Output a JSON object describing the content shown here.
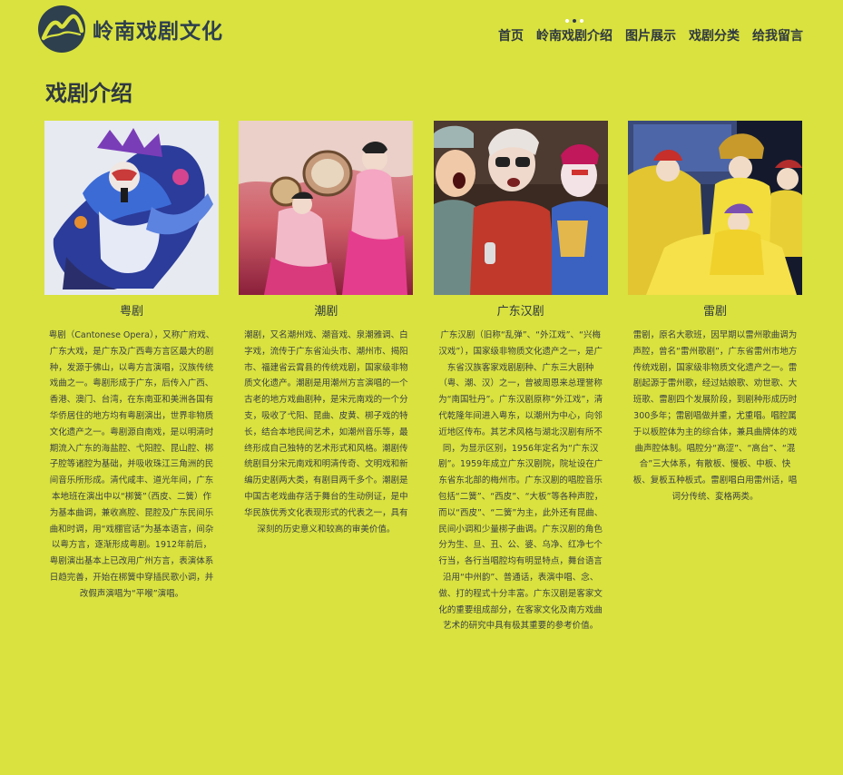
{
  "site": {
    "name": "岭南戏剧文化",
    "logo_icon": "mountain-wave-logo"
  },
  "nav": {
    "items": [
      {
        "label": "首页",
        "active": false
      },
      {
        "label": "岭南戏剧介绍",
        "active": true
      },
      {
        "label": "图片展示",
        "active": false
      },
      {
        "label": "戏剧分类",
        "active": false
      },
      {
        "label": "给我留言",
        "active": false
      }
    ]
  },
  "main": {
    "title": "戏剧介绍",
    "cards": [
      {
        "title": "粤剧",
        "image": "cantonese-opera-performer-photo",
        "text": "粤剧（Cantonese Opera），又称广府戏、广东大戏，是广东及广西粤方言区最大的剧种，发源于佛山，以粤方言演唱，汉族传统戏曲之一。粤剧形成于广东，后传入广西、香港、澳门、台湾，在东南亚和美洲各国有华侨居住的地方均有粤剧演出，世界非物质文化遗产之一。粤剧源自南戏，是以明清时期流入广东的海盐腔、弋阳腔、昆山腔、梆子腔等诸腔为基础，并吸收珠江三角洲的民间音乐所形成。清代咸丰、道光年间，广东本地班在演出中以“梆簧”（西皮、二簧）作为基本曲调，兼收高腔、昆腔及广东民间乐曲和时调，用“戏棚官话”为基本语言，间杂以粤方言，逐渐形成粤剧。1912年前后，粤剧演出基本上已改用广州方言，表演体系日趋完善，开始在梆簧中穿插民歌小调，并改假声演唱为“平喉”演唱。"
      },
      {
        "title": "潮剧",
        "image": "teochew-opera-dancers-photo",
        "text": "潮剧，又名潮州戏、潮音戏、泉潮雅调、白字戏，流传于广东省汕头市、潮州市、揭阳市、福建省云霄县的传统戏剧，国家级非物质文化遗产。潮剧是用潮州方言演唱的一个古老的地方戏曲剧种，是宋元南戏的一个分支，吸收了弋阳、昆曲、皮黄、梆子戏的特长，结合本地民间艺术，如潮州音乐等，最终形成自己独特的艺术形式和风格。潮剧传统剧目分宋元南戏和明清传奇、文明戏和新编历史剧两大类，有剧目两千多个。潮剧是中国古老戏曲存活于舞台的生动例证，是中华民族优秀文化表现形式的代表之一，具有深刻的历史意义和较高的审美价值。"
      },
      {
        "title": "广东汉剧",
        "image": "han-opera-children-and-elder-photo",
        "text": "广东汉剧（旧称“乱弹”、“外江戏”、“兴梅汉戏”），国家级非物质文化遗产之一，是广东省汉族客家戏剧剧种、广东三大剧种（粤、潮、汉）之一，曾被周恩来总理誉称为“南国牡丹”。广东汉剧原称“外江戏”，清代乾隆年间进入粤东，以潮州为中心，向邻近地区传布。其艺术风格与湖北汉剧有所不同，为显示区别，1956年定名为“广东汉剧”。1959年成立广东汉剧院，院址设在广东省东北部的梅州市。广东汉剧的唱腔音乐包括“二簧”、“西皮”、“大板”等各种声腔，而以“西皮”、“二簧”为主，此外还有昆曲、民间小调和少量梆子曲调。广东汉剧的角色分为生、旦、丑、公、婆、乌净、红净七个行当，各行当唱腔均有明显特点，舞台语言沿用“中州韵”、普通话，表演中唱、念、做、打的程式十分丰富。广东汉剧是客家文化的重要组成部分，在客家文化及南方戏曲艺术的研究中具有极其重要的参考价值。"
      },
      {
        "title": "雷剧",
        "image": "leiju-opera-stage-photo",
        "text": "雷剧，原名大歌班，因早期以雷州歌曲调为声腔，曾名“雷州歌剧”，广东省雷州市地方传统戏剧，国家级非物质文化遗产之一。雷剧起源于雷州歌，经过姑娘歌、劝世歌、大班歌、雷剧四个发展阶段，到剧种形成历时300多年；雷剧唱做并重，尤重唱。唱腔属于以板腔体为主的综合体，兼具曲牌体的戏曲声腔体制。唱腔分“高涩”、“高台”、“混合”三大体系，有散板、慢板、中板、快板、复板五种板式。雷剧唱白用雷州话，唱词分传统、変格两类。"
      }
    ]
  }
}
